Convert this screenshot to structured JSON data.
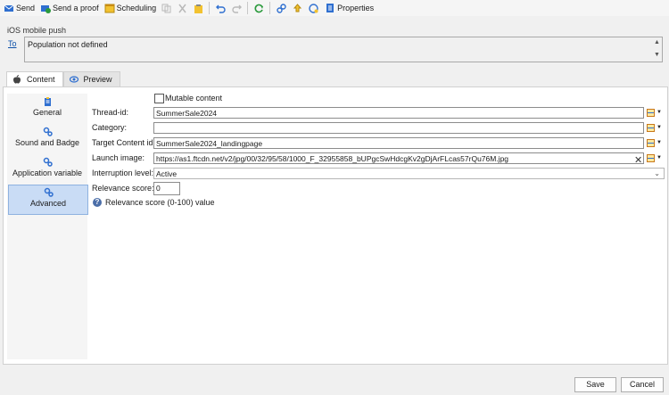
{
  "toolbar": {
    "send": "Send",
    "send_proof": "Send a proof",
    "scheduling": "Scheduling",
    "properties": "Properties"
  },
  "delivery": {
    "section_title": "iOS mobile push",
    "to_label": "To",
    "to_value": "Population not defined"
  },
  "tabs": {
    "content": "Content",
    "preview": "Preview"
  },
  "sidebar": {
    "items": [
      {
        "label": "General",
        "icon": "clipboard-icon"
      },
      {
        "label": "Sound and Badge",
        "icon": "gears-icon"
      },
      {
        "label": "Application variable",
        "icon": "gears-icon"
      },
      {
        "label": "Advanced",
        "icon": "gears-icon",
        "active": true
      }
    ]
  },
  "form": {
    "mutable_content_label": "Mutable content",
    "mutable_content_checked": false,
    "thread_id_label": "Thread-id:",
    "thread_id_value": "SummerSale2024",
    "category_label": "Category:",
    "category_value": "",
    "target_content_label": "Target Content id:",
    "target_content_value": "SummerSale2024_landingpage",
    "launch_image_label": "Launch image:",
    "launch_image_value": "https://as1.ftcdn.net/v2/jpg/00/32/95/58/1000_F_32955858_bUPgcSwHdcgKv2gDjArFLcas57rQu76M.jpg",
    "interruption_label": "Interruption level:",
    "interruption_value": "Active",
    "relevance_label": "Relevance score:",
    "relevance_value": "0",
    "relevance_help": "Relevance score (0-100) value"
  },
  "buttons": {
    "save": "Save",
    "cancel": "Cancel"
  },
  "colors": {
    "accent_blue": "#0b4fa8",
    "active_sidebar": "#c9dcf5"
  }
}
